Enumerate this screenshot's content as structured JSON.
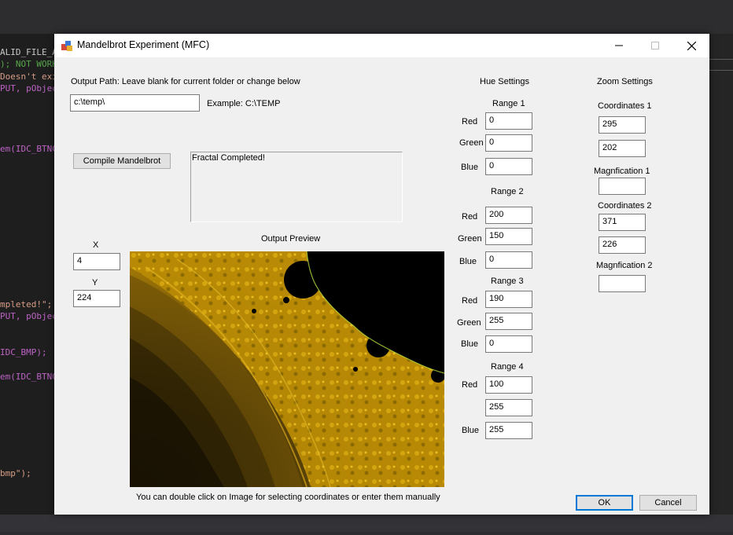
{
  "dialog": {
    "title": "Mandelbrot Experiment (MFC)",
    "output_path_label": "Output Path: Leave blank for current folder or change below",
    "output_path_value": "c:\\temp\\",
    "example_label": "Example: C:\\TEMP",
    "compile_button": "Compile Mandelbrot",
    "status_text": "Fractal Completed!",
    "output_preview_label": "Output Preview",
    "preview_hint": "You can double click on Image for selecting coordinates or enter them manually",
    "x_label": "X",
    "x_value": "4",
    "y_label": "Y",
    "y_value": "224",
    "ok_button": "OK",
    "cancel_button": "Cancel"
  },
  "hue": {
    "title": "Hue Settings",
    "red_label": "Red",
    "green_label": "Green",
    "blue_label": "Blue",
    "range1": {
      "label": "Range 1",
      "red": "0",
      "green": "0",
      "blue": "0"
    },
    "range2": {
      "label": "Range 2",
      "red": "200",
      "green": "150",
      "blue": "0"
    },
    "range3": {
      "label": "Range 3",
      "red": "190",
      "green": "255",
      "blue": "0"
    },
    "range4": {
      "label": "Range 4",
      "red": "100",
      "green": "255",
      "blue": "255"
    }
  },
  "zoom": {
    "title": "Zoom Settings",
    "coordinates1_label": "Coordinates 1",
    "coord1_x": "295",
    "coord1_y": "202",
    "magnification1_label": "Magnfication 1",
    "magnification1_value": "",
    "coordinates2_label": "Coordinates 2",
    "coord2_x": "371",
    "coord2_y": "226",
    "magnification2_label": "Magnfication 2",
    "magnification2_value": ""
  },
  "background_code": {
    "lines": [
      {
        "text": "ALID_FILE_A",
        "color": "#c8c8c8"
      },
      {
        "text": "); NOT WORK",
        "color": "#57a64a"
      },
      {
        "text": "Doesn't exi",
        "color": "#d69d85"
      },
      {
        "text": "PUT, pObjec",
        "color": "#bd63c5"
      },
      {
        "text": "em(IDC_BTNC",
        "color": "#bd63c5"
      },
      {
        "text": "mpleted!\";",
        "color": "#d69d85"
      },
      {
        "text": "PUT, pObjec",
        "color": "#bd63c5"
      },
      {
        "text": "IDC_BMP);",
        "color": "#bd63c5"
      },
      {
        "text": "em(IDC_BTNC",
        "color": "#bd63c5"
      },
      {
        "text": "bmp\");",
        "color": "#d69d85"
      }
    ]
  },
  "colors": {
    "accent": "#0078d7",
    "dialog_bg": "#f0f0f0",
    "fractal_gold": "#c89600",
    "fractal_dark": "#1a1303"
  }
}
